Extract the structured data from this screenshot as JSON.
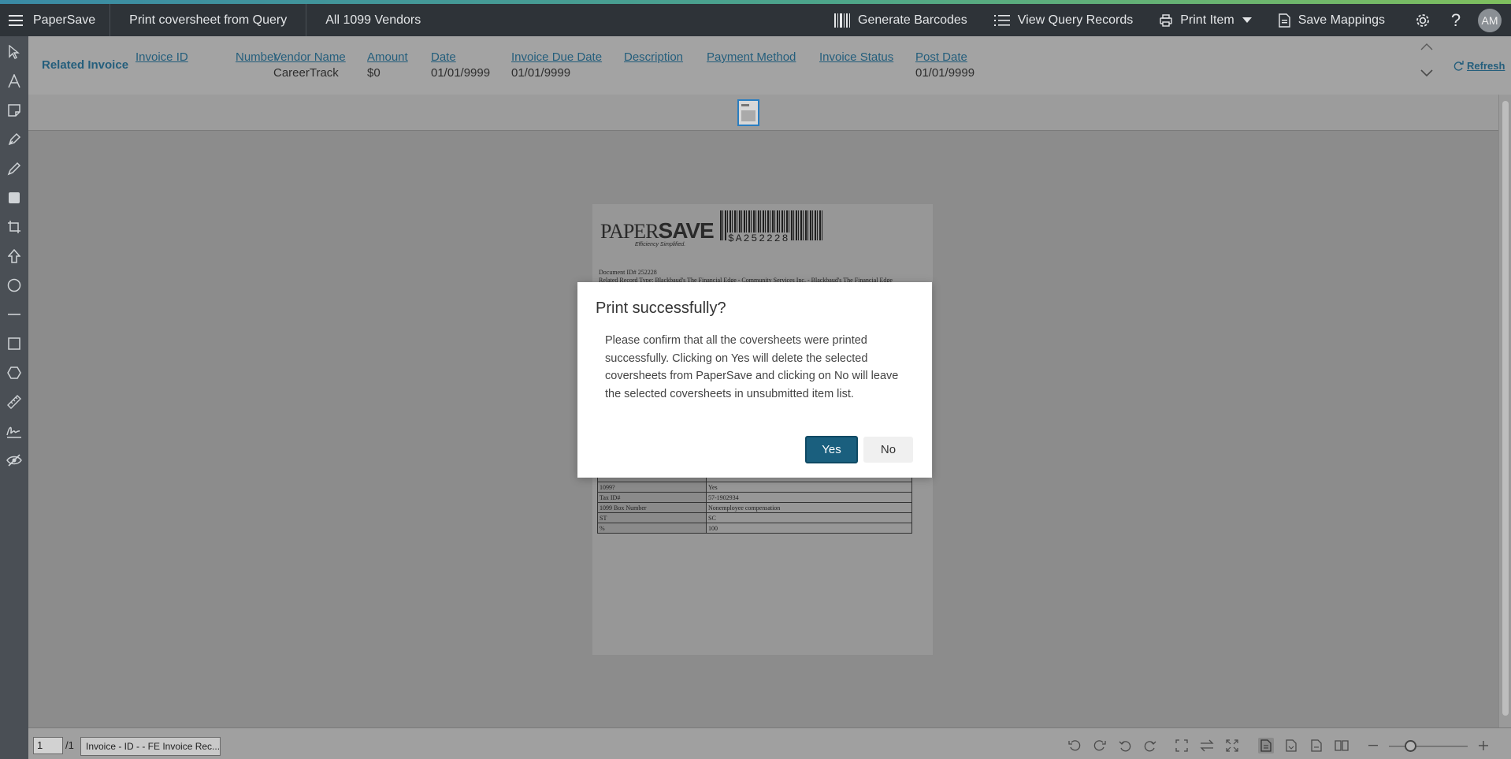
{
  "app": {
    "name": "PaperSave"
  },
  "breadcrumbs": [
    "Print coversheet from Query",
    "All 1099 Vendors"
  ],
  "topbar_actions": {
    "generate_barcodes": "Generate Barcodes",
    "view_query_records": "View Query Records",
    "print_item": "Print Item",
    "save_mappings": "Save Mappings",
    "avatar_initials": "AM"
  },
  "invoice_bar": {
    "title": "Related Invoice",
    "columns": [
      {
        "header": "Invoice ID",
        "value": ""
      },
      {
        "header": "Number",
        "value": ""
      },
      {
        "header": "Vendor Name",
        "value": "CareerTrack"
      },
      {
        "header": "Amount",
        "value": "$0"
      },
      {
        "header": "Date",
        "value": "01/01/9999"
      },
      {
        "header": "Invoice Due Date",
        "value": "01/01/9999"
      },
      {
        "header": "Description",
        "value": ""
      },
      {
        "header": "Payment Method",
        "value": ""
      },
      {
        "header": "Invoice Status",
        "value": ""
      },
      {
        "header": "Post Date",
        "value": "01/01/9999"
      }
    ],
    "refresh_label": "Refresh"
  },
  "document": {
    "logo_text": "PAPER",
    "logo_bold": "SAVE",
    "tagline": "Efficiency Simplified.",
    "barcode_text": "$A252228",
    "doc_id_line": "Document ID# 252228",
    "related_line": "Related Record Type: Blackbaud's The Financial Edge - Community Services Inc. - Blackbaud's The Financial Edge",
    "table": [
      {
        "k": "",
        "v": ""
      },
      {
        "k": "1099?",
        "v": "Yes"
      },
      {
        "k": "Tax ID#",
        "v": "57-1902934"
      },
      {
        "k": "1099 Box Number",
        "v": "Nonemployee compensation"
      },
      {
        "k": "ST",
        "v": "SC"
      },
      {
        "k": "%",
        "v": "100"
      }
    ]
  },
  "bottom_bar": {
    "page_number": "1",
    "page_total": "/1",
    "document_select": "Invoice - ID - - FE Invoice Rec..."
  },
  "dialog": {
    "title": "Print successfully?",
    "message": "Please confirm that all the coversheets were printed successfully. Clicking on Yes will delete the selected coversheets from PaperSave and clicking on No will leave the selected coversheets in unsubmitted item list.",
    "yes_label": "Yes",
    "no_label": "No"
  },
  "colors": {
    "topbar": "#2e3338",
    "toolbar": "#4a4f55",
    "link": "#245e7c",
    "primary_button": "#1a5f7e"
  }
}
